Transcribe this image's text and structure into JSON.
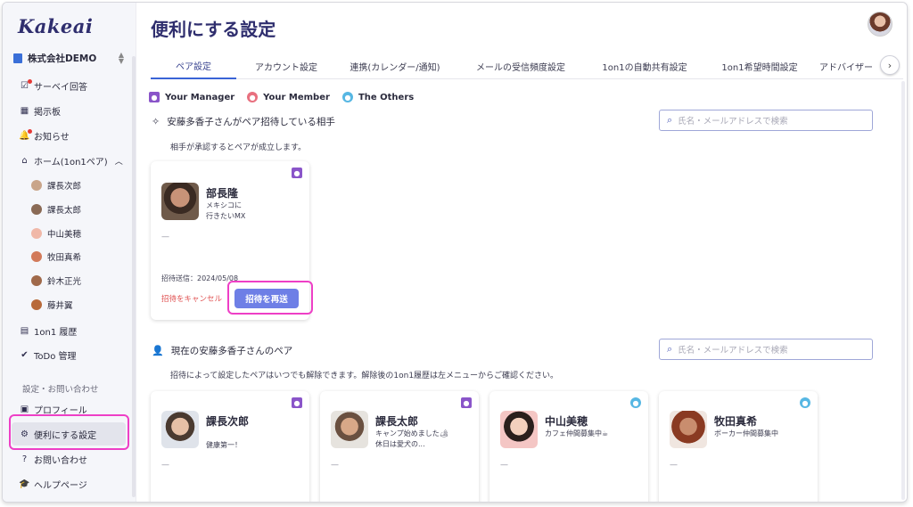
{
  "app": {
    "logo": "Kakeai",
    "company": "株式会社DEMO"
  },
  "sidebar": {
    "items": [
      {
        "label": "サーベイ回答",
        "icon": "survey-check-icon"
      },
      {
        "label": "掲示板",
        "icon": "board-icon"
      },
      {
        "label": "お知らせ",
        "icon": "bell-icon"
      },
      {
        "label": "ホーム(1on1ペア)",
        "icon": "home-icon"
      }
    ],
    "home_subitems": [
      "課長次郎",
      "課長太郎",
      "中山美穂",
      "牧田真希",
      "鈴木正光",
      "藤井翼"
    ],
    "items2": [
      {
        "label": "1on1 履歴",
        "icon": "history-icon"
      },
      {
        "label": "ToDo 管理",
        "icon": "todo-check-icon"
      }
    ],
    "settings_section": "設定・お問い合わせ",
    "items3": [
      {
        "label": "プロフィール",
        "icon": "profile-icon"
      },
      {
        "label": "便利にする設定",
        "icon": "gear-icon"
      },
      {
        "label": "お問い合わせ",
        "icon": "question-icon"
      },
      {
        "label": "ヘルプページ",
        "icon": "graduation-cap-icon"
      }
    ]
  },
  "page": {
    "title": "便利にする設定"
  },
  "tabs": [
    "ペア設定",
    "アカウント設定",
    "連携(カレンダー/通知)",
    "メールの受信頻度設定",
    "1on1の自動共有設定",
    "1on1希望時間設定",
    "アドバイザー"
  ],
  "legend": {
    "manager": "Your Manager",
    "member": "Your Member",
    "others": "The Others"
  },
  "colors": {
    "manager": "#8a55c9",
    "member": "#e8707f",
    "others": "#57b7e3",
    "accent": "#6e7fe6",
    "highlight": "#ee3fc6"
  },
  "invite_section": {
    "title": "安藤多香子さんがペア招待している相手",
    "note": "相手が承認するとペアが成立します。",
    "search_placeholder": "氏名・メールアドレスで検索",
    "card": {
      "name": "部長隆",
      "bio": "メキシコに\n行きたいMX",
      "dash": "—",
      "sent": "招待送信：2024/05/08",
      "cancel": "招待をキャンセル",
      "resend": "招待を再送"
    }
  },
  "pairs_section": {
    "title": "現在の安藤多香子さんのペア",
    "note": "招待によって設定したペアはいつでも解除できます。解除後の1on1履歴は左メニューからご確認ください。",
    "search_placeholder": "氏名・メールアドレスで検索",
    "cards": [
      {
        "name": "課長次郎",
        "bio": "健康第一！",
        "dash": "—"
      },
      {
        "name": "課長太郎",
        "bio": "キャンプ始めました🏕\n休日は愛犬の...",
        "dash": "—"
      },
      {
        "name": "中山美穂",
        "bio": "カフェ仲間募集中☕",
        "dash": "—"
      },
      {
        "name": "牧田真希",
        "bio": "ボーカー仲間募集中",
        "dash": "—"
      }
    ]
  }
}
